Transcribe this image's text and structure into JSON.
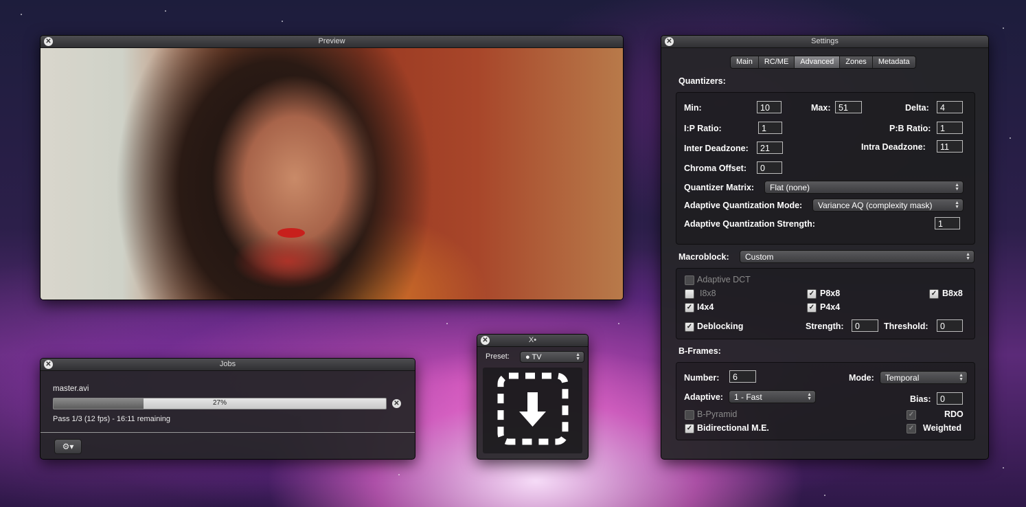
{
  "preview": {
    "title": "Preview",
    "image_alt": "woman with long dark hair and red lips, warm orange background"
  },
  "jobs": {
    "title": "Jobs",
    "filename": "master.avi",
    "progress_percent": 27,
    "progress_label": "27%",
    "status": "Pass 1/3 (12 fps) - 16:11 remaining",
    "gear_label": "⚙▾"
  },
  "drop": {
    "title": "X•",
    "preset_label": "Preset:",
    "preset_value": "TV"
  },
  "settings": {
    "title": "Settings",
    "tabs": [
      {
        "label": "Main",
        "active": false
      },
      {
        "label": "RC/ME",
        "active": false
      },
      {
        "label": "Advanced",
        "active": true
      },
      {
        "label": "Zones",
        "active": false
      },
      {
        "label": "Metadata",
        "active": false
      }
    ],
    "quantizers": {
      "heading": "Quantizers:",
      "min_label": "Min:",
      "min": "10",
      "max_label": "Max:",
      "max": "51",
      "delta_label": "Delta:",
      "delta": "4",
      "ip_label": "I:P Ratio:",
      "ip": "1",
      "pb_label": "P:B Ratio:",
      "pb": "1",
      "inter_label": "Inter Deadzone:",
      "inter": "21",
      "intra_label": "Intra Deadzone:",
      "intra": "11",
      "chroma_label": "Chroma Offset:",
      "chroma": "0",
      "matrix_label": "Quantizer Matrix:",
      "matrix": "Flat (none)",
      "aq_mode_label": "Adaptive Quantization Mode:",
      "aq_mode": "Variance AQ (complexity mask)",
      "aq_strength_label": "Adaptive Quantization Strength:",
      "aq_strength": "1"
    },
    "macroblock": {
      "heading": "Macroblock:",
      "value": "Custom",
      "adaptive_dct": "Adaptive DCT",
      "i8x8": "I8x8",
      "p8x8": "P8x8",
      "b8x8": "B8x8",
      "i4x4": "I4x4",
      "p4x4": "P4x4",
      "deblocking": "Deblocking",
      "strength_label": "Strength:",
      "strength": "0",
      "threshold_label": "Threshold:",
      "threshold": "0"
    },
    "bframes": {
      "heading": "B-Frames:",
      "number_label": "Number:",
      "number": "6",
      "mode_label": "Mode:",
      "mode": "Temporal",
      "adaptive_label": "Adaptive:",
      "adaptive": "1 - Fast",
      "bias_label": "Bias:",
      "bias": "0",
      "bpyramid": "B-Pyramid",
      "rdo": "RDO",
      "bidir": "Bidirectional M.E.",
      "weighted": "Weighted"
    }
  }
}
